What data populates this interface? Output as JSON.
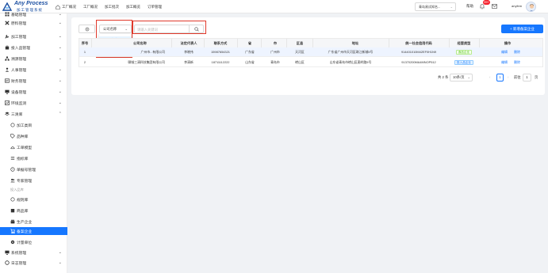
{
  "app": {
    "logo_title": "Any Process",
    "logo_subtitle": "加工管理系统",
    "brand_color": "#1677ff"
  },
  "topnav": {
    "items": [
      "工厂概况",
      "工厂概况",
      "加工批次",
      "加工概览",
      "订单管理"
    ],
    "tenant_select": "青岛易试知名...",
    "help": "帮助",
    "notification_count": "99+",
    "username": "anyfem"
  },
  "sidebar": {
    "items": [
      {
        "label": "基础管理",
        "icon": "grid-icon"
      },
      {
        "label": "原料管理",
        "icon": "close-x-icon"
      },
      {
        "label": "加工管理",
        "icon": "wrench-icon"
      },
      {
        "label": "投入品管理",
        "icon": "bag-icon"
      },
      {
        "label": "溯源管理",
        "icon": "network-icon"
      },
      {
        "label": "人事管理",
        "icon": "person-icon"
      },
      {
        "label": "财务管理",
        "icon": "finance-icon"
      },
      {
        "label": "设备管理",
        "icon": "monitor-icon"
      },
      {
        "label": "环境监测",
        "icon": "chart-icon"
      },
      {
        "label": "三清库",
        "icon": "layers-icon"
      }
    ],
    "sub_items": [
      {
        "label": "加工类目",
        "icon": "circle-icon"
      },
      {
        "label": "品种库",
        "icon": "tag-icon"
      },
      {
        "label": "工单模型",
        "icon": "model-icon"
      },
      {
        "label": "指标库",
        "icon": "list-icon"
      },
      {
        "label": "单据号管理",
        "icon": "clock-icon"
      },
      {
        "label": "专家管理",
        "icon": "users-icon"
      }
    ],
    "group_label": "投入品库",
    "group_items": [
      {
        "label": "规则库",
        "icon": "circle-icon"
      },
      {
        "label": "商品库",
        "icon": "box-icon"
      },
      {
        "label": "生产企业",
        "icon": "factory-icon"
      },
      {
        "label": "备案企业",
        "icon": "cart-icon"
      },
      {
        "label": "计量单位",
        "icon": "gear-icon"
      }
    ],
    "bottom_items": [
      {
        "label": "系统管理",
        "icon": "monitor-icon"
      },
      {
        "label": "日志管理",
        "icon": "log-icon"
      }
    ]
  },
  "toolbar": {
    "field_select": "公司名称",
    "search_placeholder": "请输入关键词",
    "add_button": "+ 新增备案企业"
  },
  "dropdown": {
    "options": [
      "公司名称",
      "法定代表人"
    ]
  },
  "table": {
    "columns": [
      "序号",
      "公司名称",
      "法定代表人",
      "联系方式",
      "省",
      "市",
      "区县",
      "地址",
      "统一社会信用代码",
      "经营类型",
      "操作"
    ],
    "rows": [
      {
        "index": "1",
        "company": "广州市...有限公司",
        "legal_rep": "李晓伟",
        "phone": "15987654321",
        "province": "广东省",
        "city": "广州市",
        "district": "天河区",
        "address": "广东省广州市天河区珠江新城5号",
        "credit_code": "914401010M42EF0H1N9",
        "type": "食品企业",
        "type_color": "green",
        "actions": [
          "编辑",
          "删除"
        ]
      },
      {
        "index": "2",
        "company": "聊城三清科技集团有限公司",
        "legal_rep": "李清新",
        "phone": "18711112222",
        "province": "山东省",
        "city": "青岛市",
        "district": "崂山区",
        "address": "山东省青岛市崂山区麦岭路5号",
        "credit_code": "91370200MA4MNOP512",
        "type": "投入品企业",
        "type_color": "blue",
        "actions": [
          "编辑",
          "删除"
        ]
      }
    ]
  },
  "pagination": {
    "total": "共 2 条",
    "page_size": "10条/页",
    "current": "1",
    "goto_label": "前往",
    "goto_value": "1",
    "page_suffix": "页"
  }
}
